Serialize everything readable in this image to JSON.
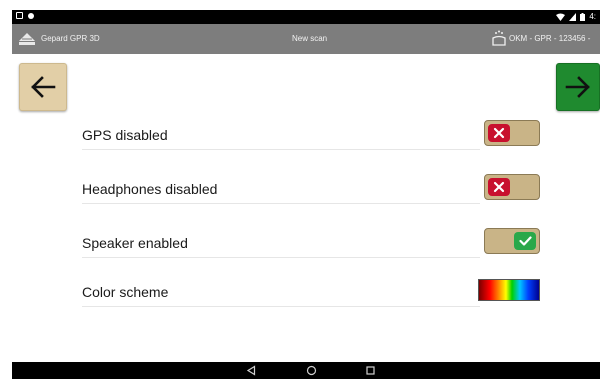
{
  "status_bar": {
    "time_text": "4:"
  },
  "app_bar": {
    "app_name": "Gepard GPR 3D",
    "screen_title": "New scan",
    "device_name": "OKM - GPR - 123456 -"
  },
  "navigation": {
    "back_icon": "arrow-left-icon",
    "next_icon": "arrow-right-icon"
  },
  "settings": [
    {
      "label": "GPS disabled",
      "state": "off"
    },
    {
      "label": "Headphones disabled",
      "state": "off"
    },
    {
      "label": "Speaker enabled",
      "state": "on"
    },
    {
      "label": "Color scheme",
      "state": "gradient"
    }
  ],
  "system_nav": {
    "back": "triangle-back-icon",
    "home": "circle-home-icon",
    "recents": "square-recents-icon"
  },
  "colors": {
    "app_bar": "#7d7d7d",
    "back_button": "#e2cfa7",
    "next_button": "#1f8a2f",
    "toggle_track": "#c9b487",
    "toggle_off": "#c8102e",
    "toggle_on": "#2aa84a"
  }
}
